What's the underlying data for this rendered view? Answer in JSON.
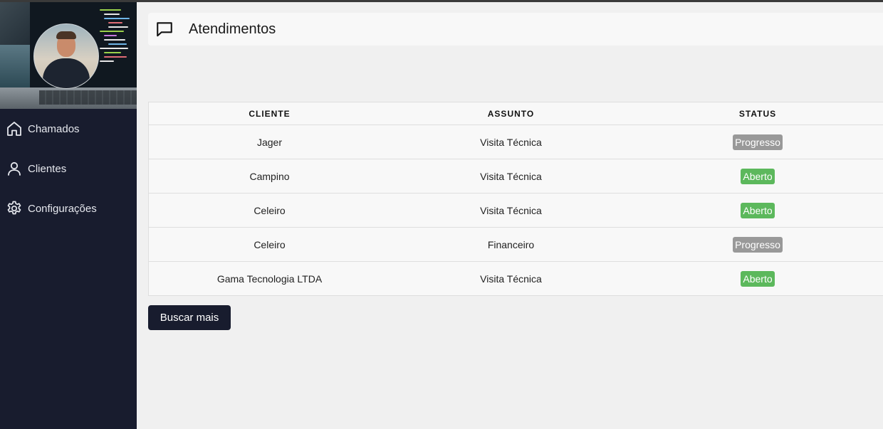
{
  "sidebar": {
    "items": [
      {
        "label": "Chamados",
        "icon": "home-icon"
      },
      {
        "label": "Clientes",
        "icon": "user-icon"
      },
      {
        "label": "Configurações",
        "icon": "gear-icon"
      }
    ]
  },
  "header": {
    "title": "Atendimentos",
    "icon": "chat-icon"
  },
  "table": {
    "columns": [
      "CLIENTE",
      "ASSUNTO",
      "STATUS"
    ],
    "rows": [
      {
        "cliente": "Jager",
        "assunto": "Visita Técnica",
        "status": "Progresso",
        "status_color": "#999999"
      },
      {
        "cliente": "Campino",
        "assunto": "Visita Técnica",
        "status": "Aberto",
        "status_color": "#5cb85c"
      },
      {
        "cliente": "Celeiro",
        "assunto": "Visita Técnica",
        "status": "Aberto",
        "status_color": "#5cb85c"
      },
      {
        "cliente": "Celeiro",
        "assunto": "Financeiro",
        "status": "Progresso",
        "status_color": "#999999"
      },
      {
        "cliente": "Gama Tecnologia LTDA",
        "assunto": "Visita Técnica",
        "status": "Aberto",
        "status_color": "#5cb85c"
      }
    ]
  },
  "actions": {
    "load_more_label": "Buscar mais"
  },
  "colors": {
    "sidebar_bg": "#181c2e",
    "page_bg": "#f0f0f0",
    "progress": "#999999",
    "open": "#5cb85c"
  }
}
